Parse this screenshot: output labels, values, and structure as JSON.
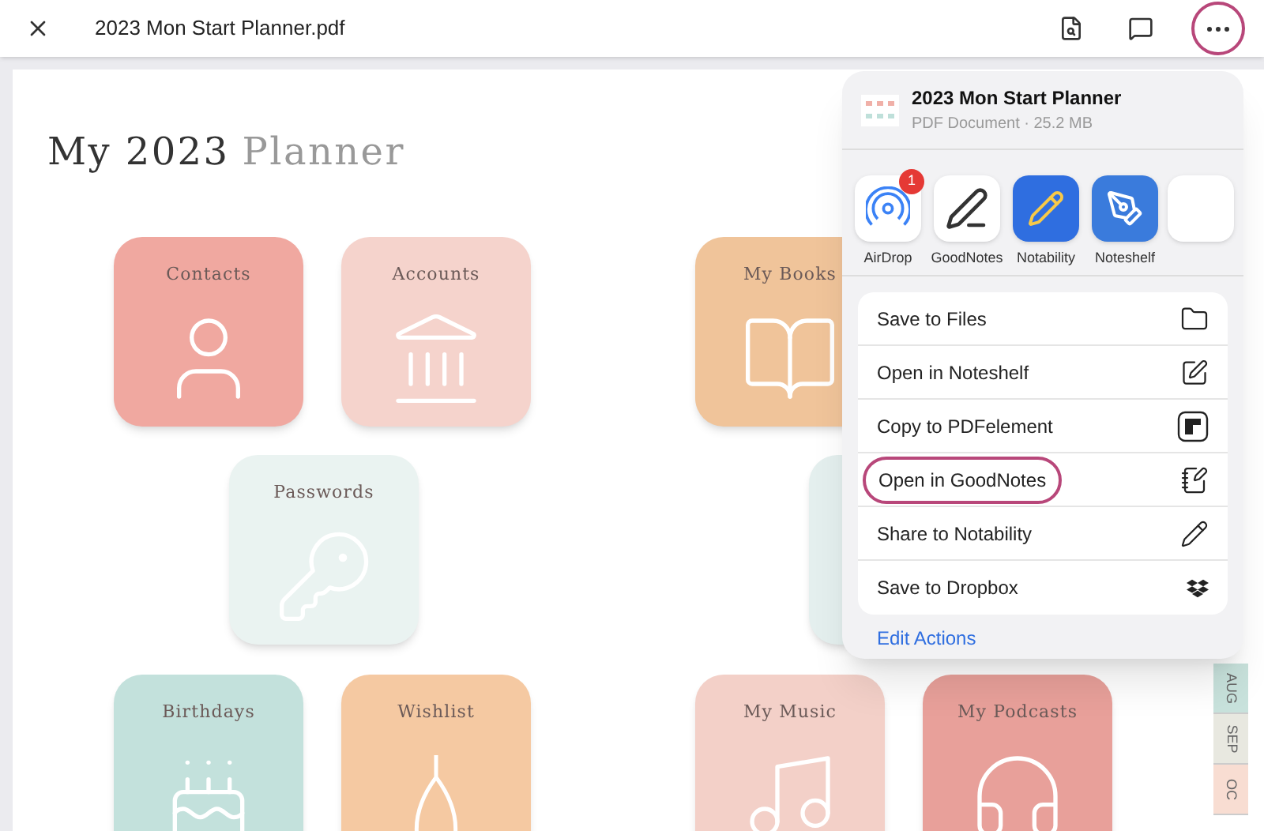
{
  "top_bar": {
    "file_name": "2023 Mon Start Planner.pdf",
    "more_circled": true
  },
  "planner": {
    "title_main": "My 2023",
    "title_accent": "Planner",
    "rows": [
      [
        {
          "label": "Contacts",
          "kind": "person",
          "color": "#f0a8a0"
        },
        {
          "label": "Accounts",
          "kind": "bank",
          "color": "#f5d3cc"
        },
        {
          "label": "My Books",
          "kind": "books",
          "color": "#f0c49a"
        }
      ],
      [
        {
          "label": "Passwords",
          "kind": "key",
          "color": "#eaf3f1"
        },
        {
          "kind": "blank",
          "color": "#e4efee"
        }
      ],
      [
        {
          "label": "Birthdays",
          "kind": "cake",
          "color": "#c3e1dc"
        },
        {
          "label": "Wishlist",
          "kind": "wishbone",
          "color": "#f5c9a2"
        },
        {
          "label": "My Music",
          "kind": "music",
          "color": "#f3d0c8"
        },
        {
          "label": "My Podcasts",
          "kind": "headphones",
          "color": "#e8a09a"
        }
      ]
    ],
    "month_tabs": [
      {
        "label": "AUG",
        "color": "#c8e2dc"
      },
      {
        "label": "SEP",
        "color": "#e8e8e0"
      },
      {
        "label": "OC",
        "color": "#f8ddd2"
      }
    ]
  },
  "share_sheet": {
    "title": "2023 Mon Start Planner",
    "subtitle": "PDF Document · 25.2 MB",
    "apps": [
      {
        "name": "AirDrop",
        "kind": "airdrop",
        "badge": "1"
      },
      {
        "name": "GoodNotes",
        "kind": "goodnotes"
      },
      {
        "name": "Notability",
        "kind": "notability"
      },
      {
        "name": "Noteshelf",
        "kind": "noteshelf"
      }
    ],
    "actions": [
      {
        "label": "Save to Files",
        "kind": "folder",
        "circled": false
      },
      {
        "label": "Open in Noteshelf",
        "kind": "pen-square",
        "circled": false
      },
      {
        "label": "Copy to PDFelement",
        "kind": "block",
        "circled": false
      },
      {
        "label": "Open in GoodNotes",
        "kind": "note-pen",
        "circled": true
      },
      {
        "label": "Share to Notability",
        "kind": "pencil",
        "circled": false
      },
      {
        "label": "Save to Dropbox",
        "kind": "dropbox",
        "circled": false
      }
    ],
    "edit_actions": "Edit Actions"
  }
}
